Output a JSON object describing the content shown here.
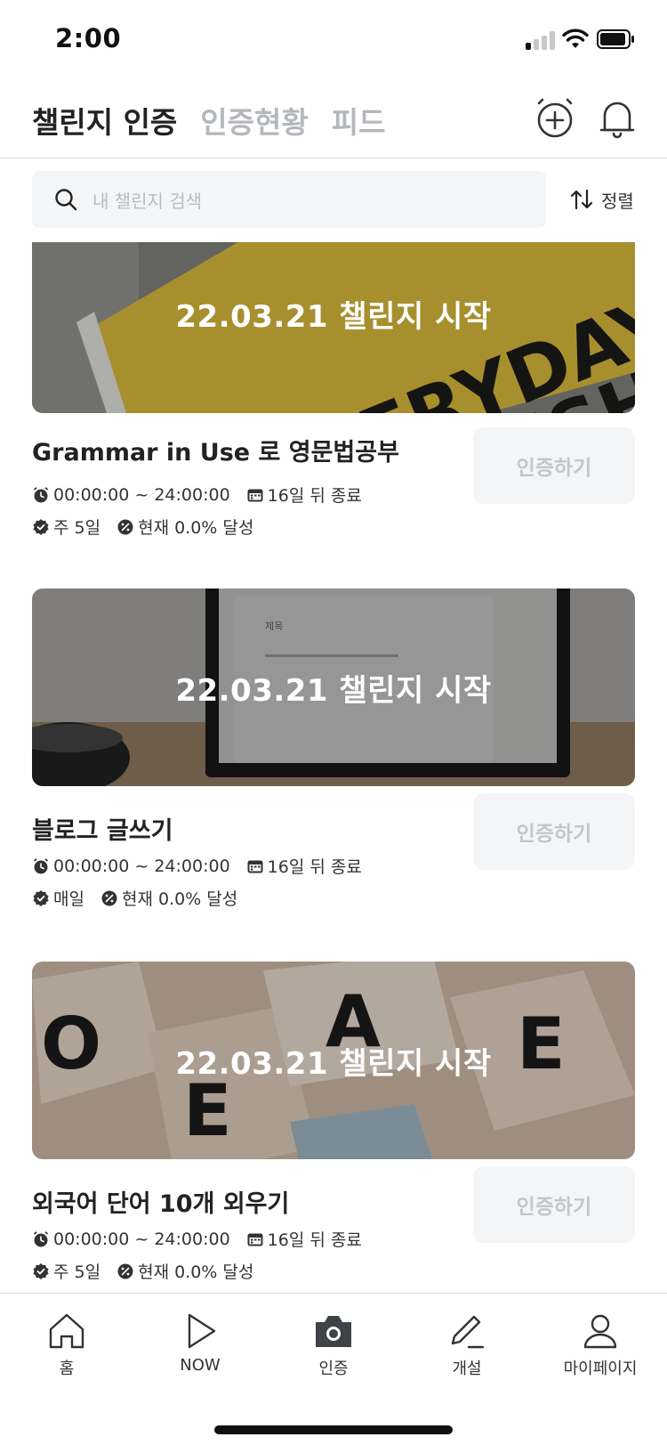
{
  "status_bar": {
    "time": "2:00"
  },
  "header": {
    "tabs": [
      {
        "label": "챌린지 인증",
        "active": true
      },
      {
        "label": "인증현황",
        "active": false
      },
      {
        "label": "피드",
        "active": false
      }
    ],
    "icons": [
      "add-alarm-icon",
      "bell-icon"
    ]
  },
  "search": {
    "placeholder": "내 챌린지 검색"
  },
  "sort": {
    "label": "정렬"
  },
  "challenges": [
    {
      "banner": "22.03.21 챌린지 시작",
      "title": "Grammar in Use 로 영문법공부",
      "time": "00:00:00 ~ 24:00:00",
      "deadline": "16일 뒤 종료",
      "frequency": "주 5일",
      "progress": "현재 0.0% 달성",
      "button": "인증하기"
    },
    {
      "banner": "22.03.21 챌린지 시작",
      "title": "블로그 글쓰기",
      "time": "00:00:00 ~ 24:00:00",
      "deadline": "16일 뒤 종료",
      "frequency": "매일",
      "progress": "현재 0.0% 달성",
      "button": "인증하기"
    },
    {
      "banner": "22.03.21 챌린지 시작",
      "title": "외국어 단어 10개 외우기",
      "time": "00:00:00 ~ 24:00:00",
      "deadline": "16일 뒤 종료",
      "frequency": "주 5일",
      "progress": "현재 0.0% 달성",
      "button": "인증하기"
    }
  ],
  "bottom_nav": [
    {
      "label": "홈",
      "icon": "home-icon"
    },
    {
      "label": "NOW",
      "icon": "play-icon"
    },
    {
      "label": "인증",
      "icon": "camera-icon"
    },
    {
      "label": "개설",
      "icon": "pencil-icon"
    },
    {
      "label": "마이페이지",
      "icon": "person-icon"
    }
  ]
}
